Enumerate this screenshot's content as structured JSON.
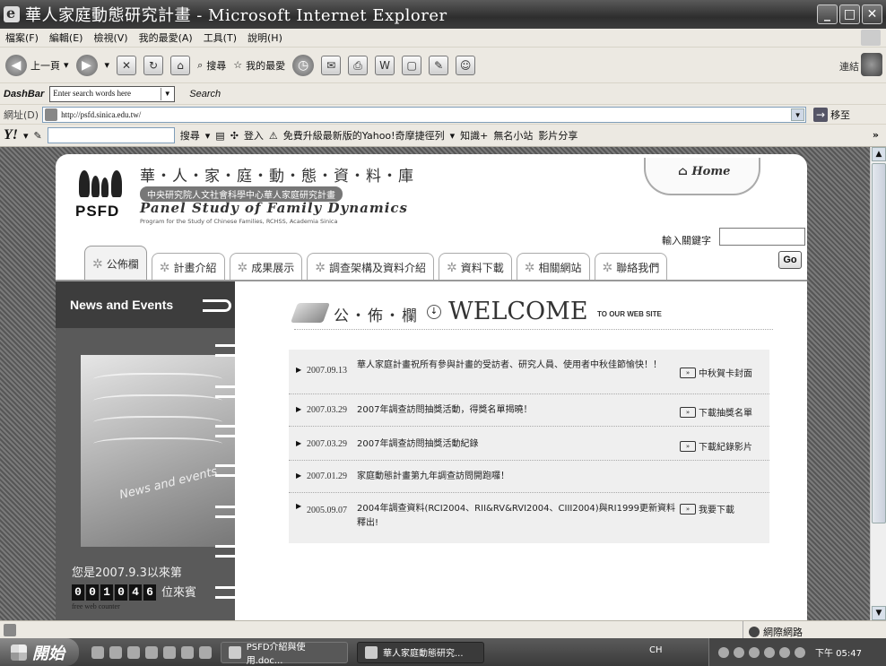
{
  "window": {
    "title": "華人家庭動態研究計畫 - Microsoft Internet Explorer",
    "buttons": [
      "_",
      "□",
      "✕"
    ]
  },
  "menu": [
    "檔案(F)",
    "編輯(E)",
    "檢視(V)",
    "我的最愛(A)",
    "工具(T)",
    "說明(H)"
  ],
  "toolbar": {
    "back": "上一頁",
    "search": "搜尋",
    "favorites": "我的最愛",
    "links": "連結"
  },
  "dashbar": {
    "label": "DashBar",
    "placeholder": "Enter search words here",
    "search": "Search"
  },
  "address": {
    "label": "網址(D)",
    "url": "http://psfd.sinica.edu.tw/",
    "go": "移至"
  },
  "yahoo": {
    "logo": "Y!",
    "search": "搜尋",
    "login": "登入",
    "promo": "免費升級最新版的Yahoo!奇摩捷徑列",
    "knowledge": "知識+",
    "mini": "無名小站",
    "video": "影片分享",
    "more": "»"
  },
  "site": {
    "title_cn": "華・人・家・庭・動・態・資・料・庫",
    "subtitle_cn": "中央研究院人文社會科學中心華人家庭研究計畫",
    "title_en": "Panel Study of Family Dynamics",
    "title_sub": "Program for the Study of Chinese Families, RCHSS, Academia Sinica",
    "logo": "PSFD",
    "home": "Home",
    "keyword_label": "輸入關鍵字",
    "go": "Go"
  },
  "tabs": [
    {
      "label": "公佈欄",
      "active": true
    },
    {
      "label": "計畫介紹"
    },
    {
      "label": "成果展示"
    },
    {
      "label": "調查架構及資料介紹"
    },
    {
      "label": "資料下載"
    },
    {
      "label": "相關網站"
    },
    {
      "label": "聯絡我們"
    }
  ],
  "sidebar": {
    "heading": "News and Events",
    "watermark": "News and events",
    "visit_pre": "您是2007.9.3以來第",
    "counter": [
      "0",
      "0",
      "1",
      "0",
      "4",
      "6"
    ],
    "visit_post": "位來賓",
    "counter_link": "free web counter"
  },
  "welcome": {
    "cn": "公・佈・欄",
    "en": "WELCOME",
    "site": "TO OUR WEB SITE"
  },
  "news": [
    {
      "date": "2007.09.13",
      "text": "華人家庭計畫祝所有參與計畫的受訪者、研究人員、使用者中秋佳節愉快！！",
      "action": "中秋賀卡封面"
    },
    {
      "date": "2007.03.29",
      "text": "2007年調查訪問抽獎活動，得獎名單揭曉！",
      "action": "下載抽獎名單"
    },
    {
      "date": "2007.03.29",
      "text": "2007年調查訪問抽獎活動紀錄",
      "action": "下載紀錄影片"
    },
    {
      "date": "2007.01.29",
      "text": "家庭動態計畫第九年調查訪問開跑囉！",
      "action": ""
    },
    {
      "date": "2005.09.07",
      "text": "2004年調查資料(RCI2004、RII&RV&RVI2004、CIII2004)與RI1999更新資料釋出!",
      "action": "我要下載"
    }
  ],
  "status": {
    "zone": "網際網路"
  },
  "taskbar": {
    "start": "開始",
    "tasks": [
      "PSFD介紹與使用.doc...",
      "華人家庭動態研究..."
    ],
    "lang": "CH",
    "clock": "下午 05:47"
  }
}
